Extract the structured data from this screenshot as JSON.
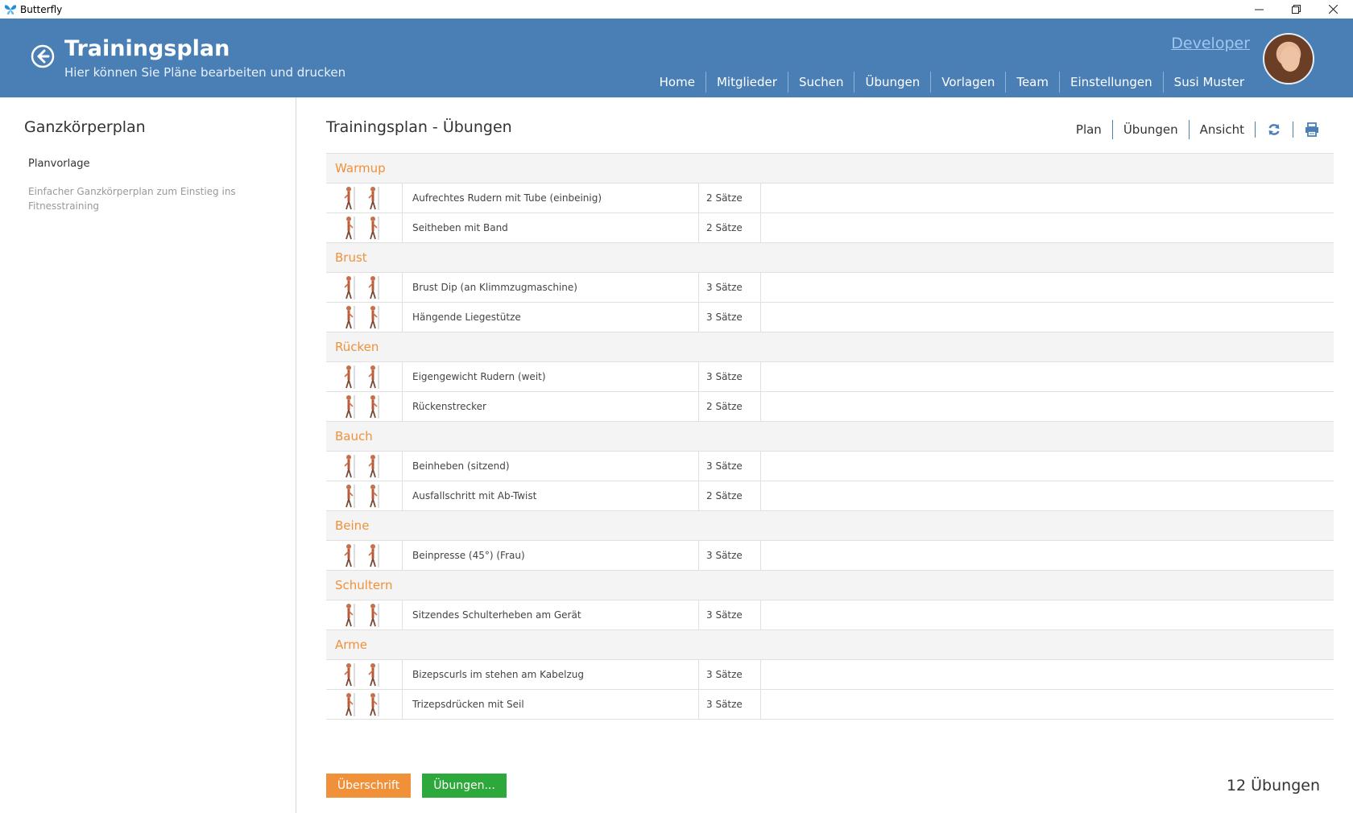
{
  "window": {
    "title": "Butterfly"
  },
  "header": {
    "title": "Trainingsplan",
    "subtitle": "Hier können Sie Pläne bearbeiten und drucken",
    "developer_link": "Developer",
    "nav": [
      "Home",
      "Mitglieder",
      "Suchen",
      "Übungen",
      "Vorlagen",
      "Team",
      "Einstellungen",
      "Susi Muster"
    ]
  },
  "sidebar": {
    "title": "Ganzkörperplan",
    "subtitle": "Planvorlage",
    "description": "Einfacher Ganzkörperplan zum Einstieg ins Fitnesstraining"
  },
  "main": {
    "title": "Trainingsplan  - Übungen",
    "toolbar": [
      "Plan",
      "Übungen",
      "Ansicht"
    ],
    "groups": [
      {
        "name": "Warmup",
        "exercises": [
          {
            "name": "Aufrechtes Rudern mit Tube (einbeinig)",
            "sets": "2 Sätze"
          },
          {
            "name": "Seitheben mit Band",
            "sets": "2 Sätze"
          }
        ]
      },
      {
        "name": "Brust",
        "exercises": [
          {
            "name": "Brust Dip (an Klimmzugmaschine)",
            "sets": "3 Sätze"
          },
          {
            "name": "Hängende Liegestütze",
            "sets": "3 Sätze"
          }
        ]
      },
      {
        "name": "Rücken",
        "exercises": [
          {
            "name": "Eigengewicht Rudern (weit)",
            "sets": "3 Sätze"
          },
          {
            "name": "Rückenstrecker",
            "sets": "2 Sätze"
          }
        ]
      },
      {
        "name": "Bauch",
        "exercises": [
          {
            "name": "Beinheben (sitzend)",
            "sets": "3 Sätze"
          },
          {
            "name": "Ausfallschritt mit Ab-Twist",
            "sets": "2 Sätze"
          }
        ]
      },
      {
        "name": "Beine",
        "exercises": [
          {
            "name": "Beinpresse (45°) (Frau)",
            "sets": "3 Sätze"
          }
        ]
      },
      {
        "name": "Schultern",
        "exercises": [
          {
            "name": "Sitzendes Schulterheben am Gerät",
            "sets": "3 Sätze"
          }
        ]
      },
      {
        "name": "Arme",
        "exercises": [
          {
            "name": "Bizepscurls im stehen am Kabelzug",
            "sets": "3 Sätze"
          },
          {
            "name": "Trizepsdrücken mit Seil",
            "sets": "3 Sätze"
          }
        ]
      }
    ],
    "buttons": {
      "heading": "Überschrift",
      "exercises": "Übungen..."
    },
    "count": "12 Übungen"
  },
  "colors": {
    "header": "#4a7fb5",
    "accent_orange": "#f0913a",
    "accent_green": "#2da83a"
  }
}
